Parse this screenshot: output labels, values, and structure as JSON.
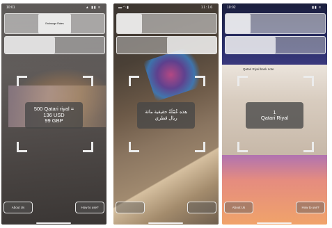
{
  "phones": [
    {
      "status": {
        "time": "10:01",
        "icons": "▲ ▮▮ ≡"
      },
      "tabs": [
        "",
        "Exchange Rates",
        ""
      ],
      "segments": [
        "",
        ""
      ],
      "result": [
        "500 Qatari riyal =",
        "136 USD",
        "99 GBP"
      ],
      "buttons": {
        "left": "About Us",
        "right": "How to use?"
      }
    },
    {
      "status": {
        "time": "",
        "icons": "11:16"
      },
      "tabs": [
        "",
        "",
        "",
        ""
      ],
      "segments": [
        "",
        ""
      ],
      "result": [
        "هذه عُمْلَةٌ حقيقية مائة",
        "ريال قطري"
      ],
      "buttons": {
        "left": "",
        "right": ""
      }
    },
    {
      "status": {
        "time": "10:02",
        "icons": "▮▮ ≡"
      },
      "tabs": [
        "",
        "",
        "",
        ""
      ],
      "segments": [
        "",
        ""
      ],
      "note_title": "Qatari Riyal bank note",
      "result": [
        "1",
        "Qatari Riyal"
      ],
      "buttons": {
        "left": "About Us",
        "right": "How to use?"
      }
    }
  ]
}
